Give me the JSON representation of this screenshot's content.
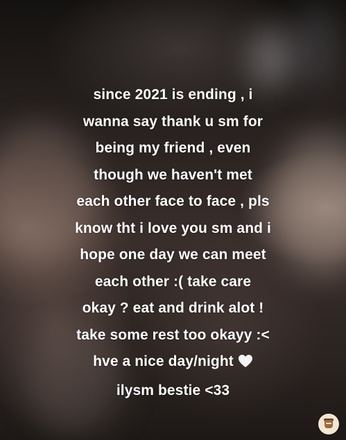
{
  "caption": {
    "lines": [
      "since 2021 is ending , i",
      "wanna say thank u sm for",
      "being my friend , even",
      "though we haven't met",
      "each other face to face , pls",
      "know tht i love you sm and i",
      "hope one day we can meet",
      "each other :( take care",
      "okay ? eat and drink alot !",
      "take some rest too okayy :<",
      "hve a nice day/night",
      "ilysm bestie <33"
    ],
    "heart_icon": "white-heart-icon",
    "text_color": "#ffffff"
  },
  "badge": {
    "icon": "coffee-cup-icon"
  }
}
